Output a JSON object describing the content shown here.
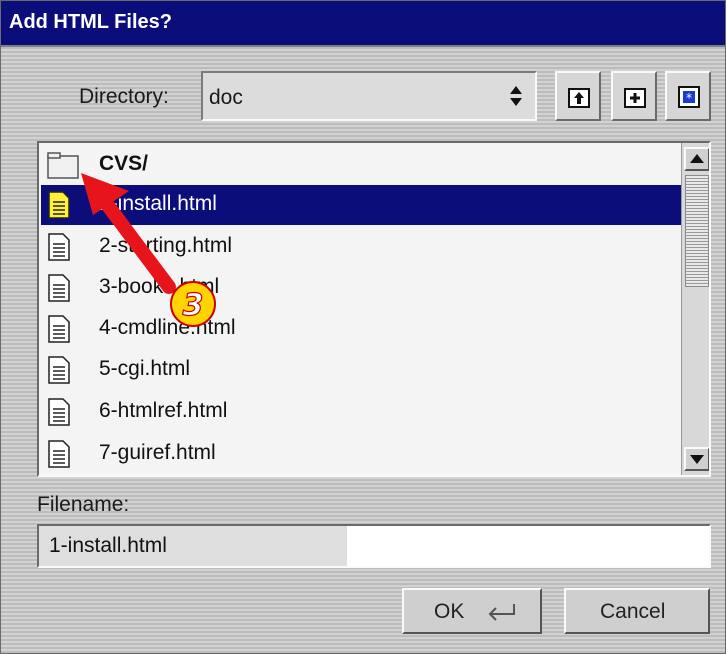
{
  "window": {
    "title": "Add HTML Files?"
  },
  "directory": {
    "label": "Directory:",
    "value": "doc"
  },
  "toolbar": {
    "icons": [
      "parent-directory-icon",
      "new-folder-icon",
      "toggle-view-icon"
    ]
  },
  "files": [
    {
      "name": "CVS/",
      "type": "folder",
      "selected": false
    },
    {
      "name": "1-install.html",
      "type": "file",
      "selected": true
    },
    {
      "name": "2-starting.html",
      "type": "file",
      "selected": false
    },
    {
      "name": "3-books.html",
      "type": "file",
      "selected": false
    },
    {
      "name": "4-cmdline.html",
      "type": "file",
      "selected": false
    },
    {
      "name": "5-cgi.html",
      "type": "file",
      "selected": false
    },
    {
      "name": "6-htmlref.html",
      "type": "file",
      "selected": false
    },
    {
      "name": "7-guiref.html",
      "type": "file",
      "selected": false
    }
  ],
  "filename": {
    "label": "Filename:",
    "value": "1-install.html"
  },
  "buttons": {
    "ok": "OK",
    "cancel": "Cancel"
  },
  "annotation": {
    "step": "3"
  },
  "colors": {
    "titlebar": "#0b0e7a",
    "selection": "#0b0e7a",
    "annotation": "#e8141c",
    "badge": "#ffd400"
  }
}
